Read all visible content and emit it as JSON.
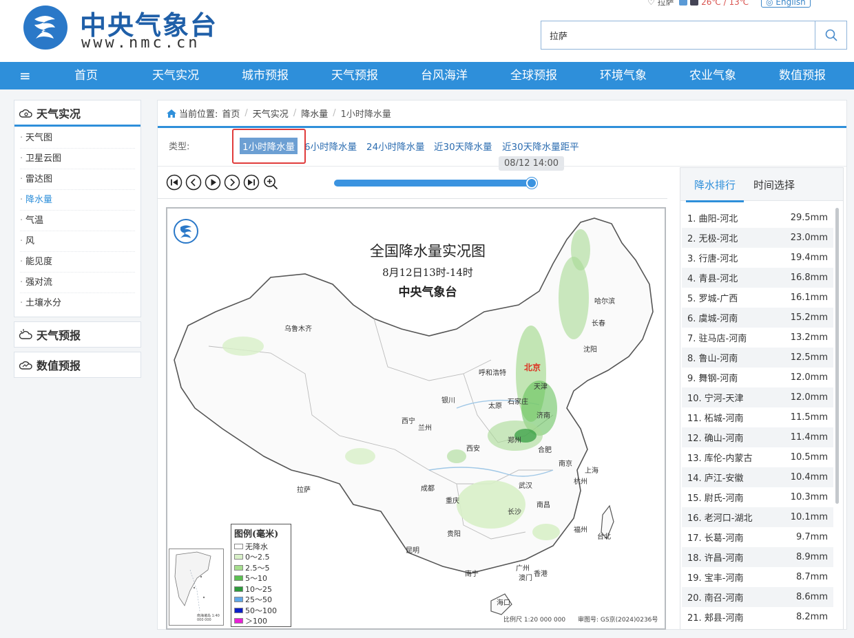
{
  "header": {
    "logo_cn": "中央气象台",
    "logo_en": "www.nmc.cn",
    "location": "拉萨",
    "temperature": "26℃ / 13℃",
    "english_link": "English",
    "search_value": "拉萨"
  },
  "nav": {
    "items": [
      "首页",
      "天气实况",
      "城市预报",
      "天气预报",
      "台风海洋",
      "全球预报",
      "环境气象",
      "农业气象",
      "数值预报"
    ]
  },
  "sidebar": {
    "section1": "天气实况",
    "items": [
      "天气图",
      "卫星云图",
      "雷达图",
      "降水量",
      "气温",
      "风",
      "能见度",
      "强对流",
      "土壤水分"
    ],
    "active_item": "降水量",
    "section2": "天气预报",
    "section3": "数值预报"
  },
  "breadcrumb": {
    "prefix": "当前位置:",
    "items": [
      "首页",
      "天气实况",
      "降水量",
      "1小时降水量"
    ]
  },
  "types": {
    "label": "类型:",
    "tabs": [
      "1小时降水量",
      "6小时降水量",
      "24小时降水量",
      "近30天降水量",
      "近30天降水量距平"
    ],
    "selected": "1小时降水量"
  },
  "player": {
    "time_label": "08/12 14:00",
    "progress": 1.0
  },
  "map": {
    "title": "全国降水量实况图",
    "subtitle": "8月12日13时-14时",
    "agency": "中央气象台",
    "cities": [
      "乌鲁木齐",
      "哈尔滨",
      "长春",
      "沈阳",
      "北京",
      "天津",
      "呼和浩特",
      "石家庄",
      "太原",
      "银川",
      "济南",
      "西宁",
      "兰州",
      "郑州",
      "西安",
      "合肥",
      "南京",
      "上海",
      "杭州",
      "成都",
      "武汉",
      "重庆",
      "拉萨",
      "长沙",
      "南昌",
      "福州",
      "台北",
      "贵阳",
      "昆明",
      "广州",
      "澳门",
      "香港",
      "南宁",
      "海口"
    ],
    "legend_title": "图例(毫米)",
    "legend": [
      {
        "label": "无降水",
        "color": "#ffffff"
      },
      {
        "label": "0～2.5",
        "color": "#d8f0c8"
      },
      {
        "label": "2.5～5",
        "color": "#a6de8e"
      },
      {
        "label": "5～10",
        "color": "#5cbf52"
      },
      {
        "label": "10～25",
        "color": "#2e9a3c"
      },
      {
        "label": "25～50",
        "color": "#61a8e8"
      },
      {
        "label": "50～100",
        "color": "#0a1fc8"
      },
      {
        "label": "＞100",
        "color": "#e81ed6"
      }
    ],
    "scale": "比例尺  1:20 000 000",
    "map_number": "审图号: GS京(2024)0236号",
    "inset_caption": "南海诸岛 1:40 000 000"
  },
  "ranking": {
    "tab_rank": "降水排行",
    "tab_time": "时间选择",
    "rows": [
      {
        "name": "1. 曲阳-河北",
        "value": "29.5mm"
      },
      {
        "name": "2. 无极-河北",
        "value": "23.0mm"
      },
      {
        "name": "3. 行唐-河北",
        "value": "19.4mm"
      },
      {
        "name": "4. 青县-河北",
        "value": "16.8mm"
      },
      {
        "name": "5. 罗城-广西",
        "value": "16.1mm"
      },
      {
        "name": "6. 虞城-河南",
        "value": "15.2mm"
      },
      {
        "name": "7. 驻马店-河南",
        "value": "13.2mm"
      },
      {
        "name": "8. 鲁山-河南",
        "value": "12.5mm"
      },
      {
        "name": "9. 舞钢-河南",
        "value": "12.0mm"
      },
      {
        "name": "10. 宁河-天津",
        "value": "12.0mm"
      },
      {
        "name": "11. 柘城-河南",
        "value": "11.5mm"
      },
      {
        "name": "12. 确山-河南",
        "value": "11.4mm"
      },
      {
        "name": "13. 库伦-内蒙古",
        "value": "10.5mm"
      },
      {
        "name": "14. 庐江-安徽",
        "value": "10.4mm"
      },
      {
        "name": "15. 尉氏-河南",
        "value": "10.3mm"
      },
      {
        "name": "16. 老河口-湖北",
        "value": "10.1mm"
      },
      {
        "name": "17. 长葛-河南",
        "value": "9.7mm"
      },
      {
        "name": "18. 许昌-河南",
        "value": "8.9mm"
      },
      {
        "name": "19. 宝丰-河南",
        "value": "8.7mm"
      },
      {
        "name": "20. 南召-河南",
        "value": "8.6mm"
      },
      {
        "name": "21. 郏县-河南",
        "value": "8.2mm"
      }
    ]
  },
  "colors": {
    "nav_blue": "#2e8fda",
    "brand_blue": "#1f5fa8",
    "highlight_red": "#e03b3b"
  }
}
